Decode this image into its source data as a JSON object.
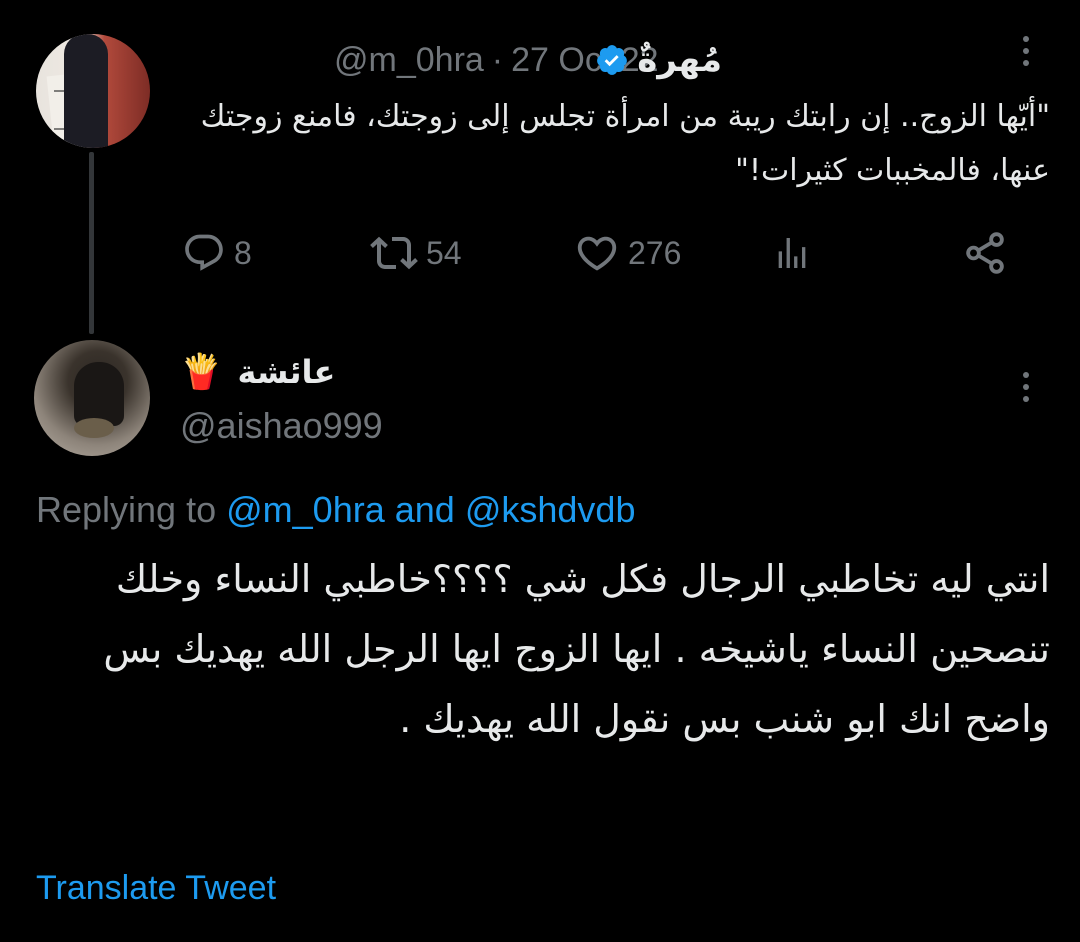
{
  "colors": {
    "background": "#000000",
    "text_primary": "#e7e9ea",
    "text_secondary": "#71767b",
    "link": "#1d9bf0",
    "verified": "#1d9bf0",
    "thread_line": "#333639"
  },
  "parent_tweet": {
    "author_name": "مُهرةٌ",
    "handle": "@m_0hra",
    "separator": "·",
    "date": "27 Oct 22",
    "verified_icon": "verified-badge-icon",
    "text": "\"أيّها الزوج.. إن رابتك ريبة من امرأة تجلس إلى زوجتك، فامنع زوجتك عنها، فالمخببات كثيرات!\"",
    "actions": {
      "replies": "8",
      "retweets": "54",
      "likes": "276"
    }
  },
  "reply_tweet": {
    "author_name": "عائشة ⁦",
    "author_emoji": "🍟",
    "handle": "@aishao999",
    "replying_prefix": "Replying to",
    "replying_user1": "@m_0hra",
    "replying_and": "and",
    "replying_user2": "@kshdvdb",
    "text": "انتي ليه تخاطبي الرجال فكل شي ؟؟؟؟خاطبي النساء وخلك تنصحين النساء ياشيخه . ايها الزوج ايها الرجل الله يهديك بس واضح انك ابو شنب بس نقول الله يهديك .",
    "translate_label": "Translate Tweet"
  }
}
